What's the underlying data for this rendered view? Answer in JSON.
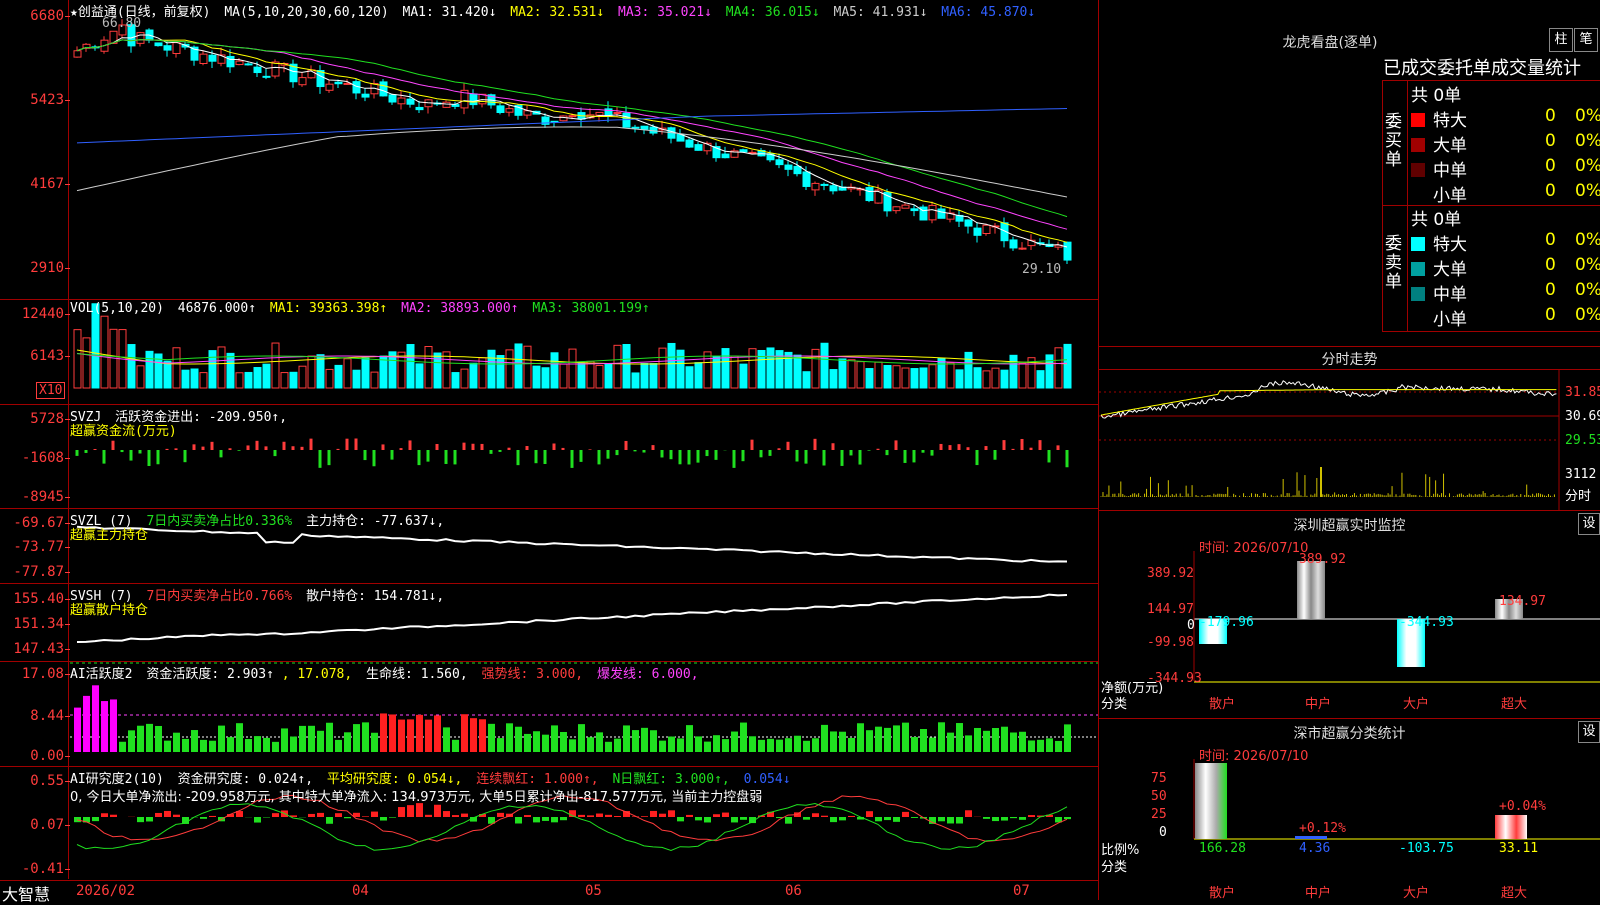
{
  "main": {
    "title": "★创益通(日线，前复权)",
    "ma_label": "MA(5,10,20,30,60,120)",
    "ma": [
      {
        "text": "MA1: 31.420↓",
        "color": "#ffffff"
      },
      {
        "text": "MA2: 32.531↓",
        "color": "#ffff00"
      },
      {
        "text": "MA3: 35.021↓",
        "color": "#ff44ff"
      },
      {
        "text": "MA4: 36.015↓",
        "color": "#20e020"
      },
      {
        "text": "MA5: 41.931↓",
        "color": "#cccccc"
      },
      {
        "text": "MA6: 45.870↓",
        "color": "#3060ff"
      }
    ],
    "axis": [
      "6680",
      "5423",
      "4167",
      "2910"
    ],
    "high_label": "66.80",
    "low_label": "29.10"
  },
  "vol": {
    "title": "VOL(5,10,20)",
    "value": "46876.000↑",
    "ma": [
      "MA1: 39363.398↑",
      "MA2: 38893.000↑",
      "MA3: 38001.199↑"
    ],
    "axis": [
      "12440",
      "6143"
    ],
    "unit": "X10"
  },
  "svzj": {
    "title": "SVZJ",
    "line1": "活跃资金进出: -209.950↑,",
    "line2": "超赢资金流(万元)",
    "axis": [
      "5728",
      "-1608",
      "-8945"
    ]
  },
  "svzl": {
    "title": "SVZL (7)",
    "ratio": "7日内买卖净占比0.336%",
    "hold": "主力持仓: -77.637↓,",
    "line2": "超赢主力持仓",
    "axis": [
      "-69.67",
      "-73.77",
      "-77.87"
    ]
  },
  "svsh": {
    "title": "SVSH (7)",
    "ratio": "7日内买卖净占比0.766%",
    "hold": "散户持仓: 154.781↓,",
    "line2": "超赢散户持仓",
    "axis": [
      "155.40",
      "151.34",
      "147.43"
    ]
  },
  "ai1": {
    "title": "AI活跃度2",
    "a": "资金活跃度: 2.903↑",
    "b": ", 17.078,",
    "c": "生命线: 1.560,",
    "d": "强势线: 3.000,",
    "e": "爆发线: 6.000,",
    "axis": [
      "17.08",
      "8.44",
      "0.00"
    ]
  },
  "ai2": {
    "title": "AI研究度2(10)",
    "a": "资金研究度: 0.024↑,",
    "b": "平均研究度: 0.054↓,",
    "c": "连续飘红: 1.000↑,",
    "d": "N日飘红: 3.000↑,",
    "e": "0.054↓",
    "line2": "0, 今日大单净流出: -209.958万元, 其中特大单净流入: 134.973万元, 大单5日累计净出-817.577万元, 当前主力控盘弱",
    "axis": [
      "0.55",
      "0.07",
      "-0.41"
    ]
  },
  "bottom": {
    "brand": "大智慧",
    "dates": [
      "2026/02",
      "04",
      "05",
      "06",
      "07"
    ]
  },
  "dragon": {
    "title": "龙虎看盘(逐单)",
    "btn1": "柱",
    "btn2": "笔",
    "subtitle": "已成交委托单成交量统计",
    "buy_side": "委买单",
    "sell_side": "委卖单",
    "buy_total": "共 0单",
    "sell_total": "共 0单",
    "buy_rows": [
      {
        "label": "特大",
        "count": "0",
        "pct": "0%",
        "color": "#ff0000"
      },
      {
        "label": "大单",
        "count": "0",
        "pct": "0%",
        "color": "#a00000"
      },
      {
        "label": "中单",
        "count": "0",
        "pct": "0%",
        "color": "#600000"
      },
      {
        "label": "小单",
        "count": "0",
        "pct": "0%",
        "color": ""
      }
    ],
    "sell_rows": [
      {
        "label": "特大",
        "count": "0",
        "pct": "0%",
        "color": "#00ffff"
      },
      {
        "label": "大单",
        "count": "0",
        "pct": "0%",
        "color": "#00a0a0"
      },
      {
        "label": "中单",
        "count": "0",
        "pct": "0%",
        "color": "#008080"
      },
      {
        "label": "小单",
        "count": "0",
        "pct": "0%",
        "color": ""
      }
    ]
  },
  "intraday": {
    "title": "分时走势",
    "axis": [
      "31.85",
      "30.69",
      "29.53",
      "3112"
    ],
    "unit": "分时"
  },
  "monitor": {
    "title": "深圳超赢实时监控",
    "btn": "设",
    "time": "时间: 2026/07/10",
    "axis": [
      "389.92",
      "144.97",
      "0",
      "-99.98",
      "-344.93"
    ],
    "unit1": "净额(万元)",
    "unit2": "分类",
    "cats": [
      "散户",
      "中户",
      "大户",
      "超大"
    ],
    "values": [
      "-179.96",
      "389.92",
      "-344.93",
      "134.97"
    ]
  },
  "classify": {
    "title": "深市超赢分类统计",
    "btn": "设",
    "time": "时间: 2026/07/10",
    "axis": [
      "75",
      "50",
      "25",
      "0"
    ],
    "unit1": "比例%",
    "unit2": "分类",
    "cats": [
      "散户",
      "中户",
      "大户",
      "超大"
    ],
    "values": [
      "166.28",
      "4.36",
      "-103.75",
      "33.11"
    ],
    "pcts": [
      "",
      "+0.12%",
      "",
      "+0.04%"
    ]
  }
}
